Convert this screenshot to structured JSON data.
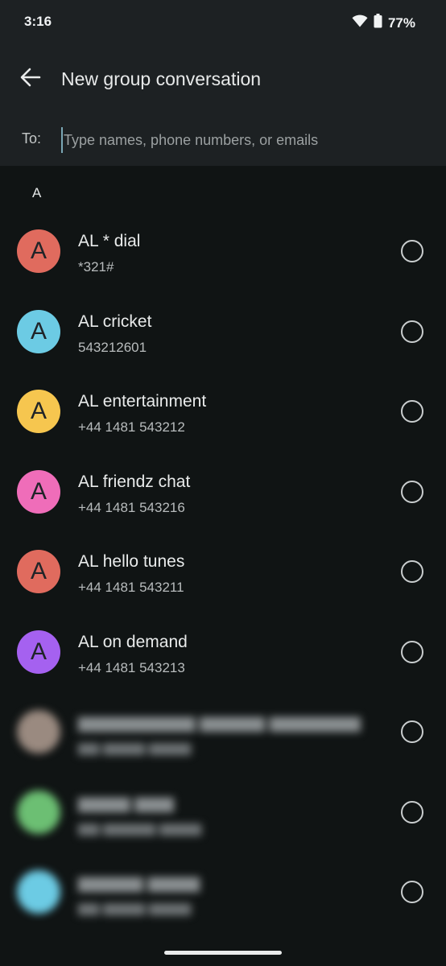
{
  "status_bar": {
    "time": "3:16",
    "battery_percent": "77%",
    "icons": [
      "wifi-icon",
      "battery-icon"
    ]
  },
  "app_bar": {
    "title": "New group conversation",
    "back_icon": "arrow-back-icon"
  },
  "recipient_field": {
    "label": "To:",
    "placeholder": "Type names, phone numbers, or emails",
    "value": ""
  },
  "section_header": "A",
  "contacts": [
    {
      "initial": "A",
      "name": "AL * dial",
      "number": "*321#",
      "color": "#e06b5e",
      "selected": false
    },
    {
      "initial": "A",
      "name": "AL cricket",
      "number": "543212601",
      "color": "#6ccbe4",
      "selected": false
    },
    {
      "initial": "A",
      "name": "AL entertainment",
      "number": "+44 1481 543212",
      "color": "#f6c64f",
      "selected": false
    },
    {
      "initial": "A",
      "name": "AL friendz chat",
      "number": "+44 1481 543216",
      "color": "#ef6db9",
      "selected": false
    },
    {
      "initial": "A",
      "name": "AL hello tunes",
      "number": "+44 1481 543211",
      "color": "#e06b5e",
      "selected": false
    },
    {
      "initial": "A",
      "name": "AL on demand",
      "number": "+44 1481 543213",
      "color": "#a561f0",
      "selected": false
    }
  ],
  "blurred_contacts": [
    {
      "initial": "",
      "color": "#9a8a80",
      "selected": false
    },
    {
      "initial": "",
      "color": "#6cbf73",
      "selected": false
    },
    {
      "initial": "",
      "color": "#6ccbe4",
      "selected": false
    }
  ],
  "colors": {
    "background": "#101414",
    "header_background": "#1d2123",
    "cursor_accent": "#7aa7b5"
  }
}
